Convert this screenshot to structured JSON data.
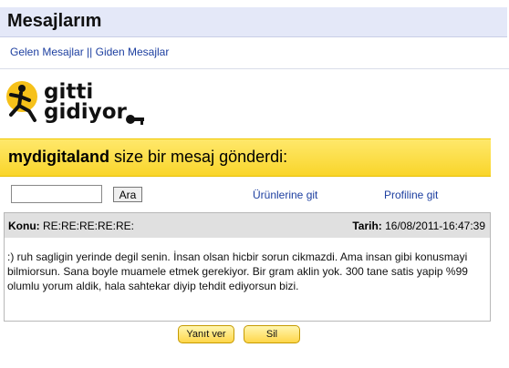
{
  "header": {
    "title": "Mesajlarım"
  },
  "nav": {
    "inbox": "Gelen Mesajlar",
    "separator": "||",
    "outbox": "Giden Mesajlar"
  },
  "logo": {
    "line1": "gitti",
    "line2": "gidiyor"
  },
  "banner": {
    "sender": "mydigitaland",
    "text": "size bir mesaj gönderdi:"
  },
  "search": {
    "value": "",
    "button": "Ara"
  },
  "links": {
    "products": "Ürünlerine git",
    "profile": "Profiline git"
  },
  "message": {
    "subject_label": "Konu:",
    "subject": "RE:RE:RE:RE:RE:",
    "date_label": "Tarih:",
    "date": "16/08/2011-16:47:39",
    "body": ":) ruh sagligin yerinde degil senin. İnsan olsan hicbir sorun cikmazdi. Ama insan gibi konusmayi bilmiorsun. Sana boyle muamele etmek gerekiyor. Bir gram aklin yok. 300 tane satis yapip %99 olumlu yorum aldik, hala sahtekar diyip tehdit ediyorsun bizi."
  },
  "actions": {
    "reply": "Yanıt ver",
    "delete": "Sil"
  },
  "colors": {
    "banner": "#f9d52a",
    "header_bg": "#e4e8f8",
    "link": "#1d3fa0"
  }
}
